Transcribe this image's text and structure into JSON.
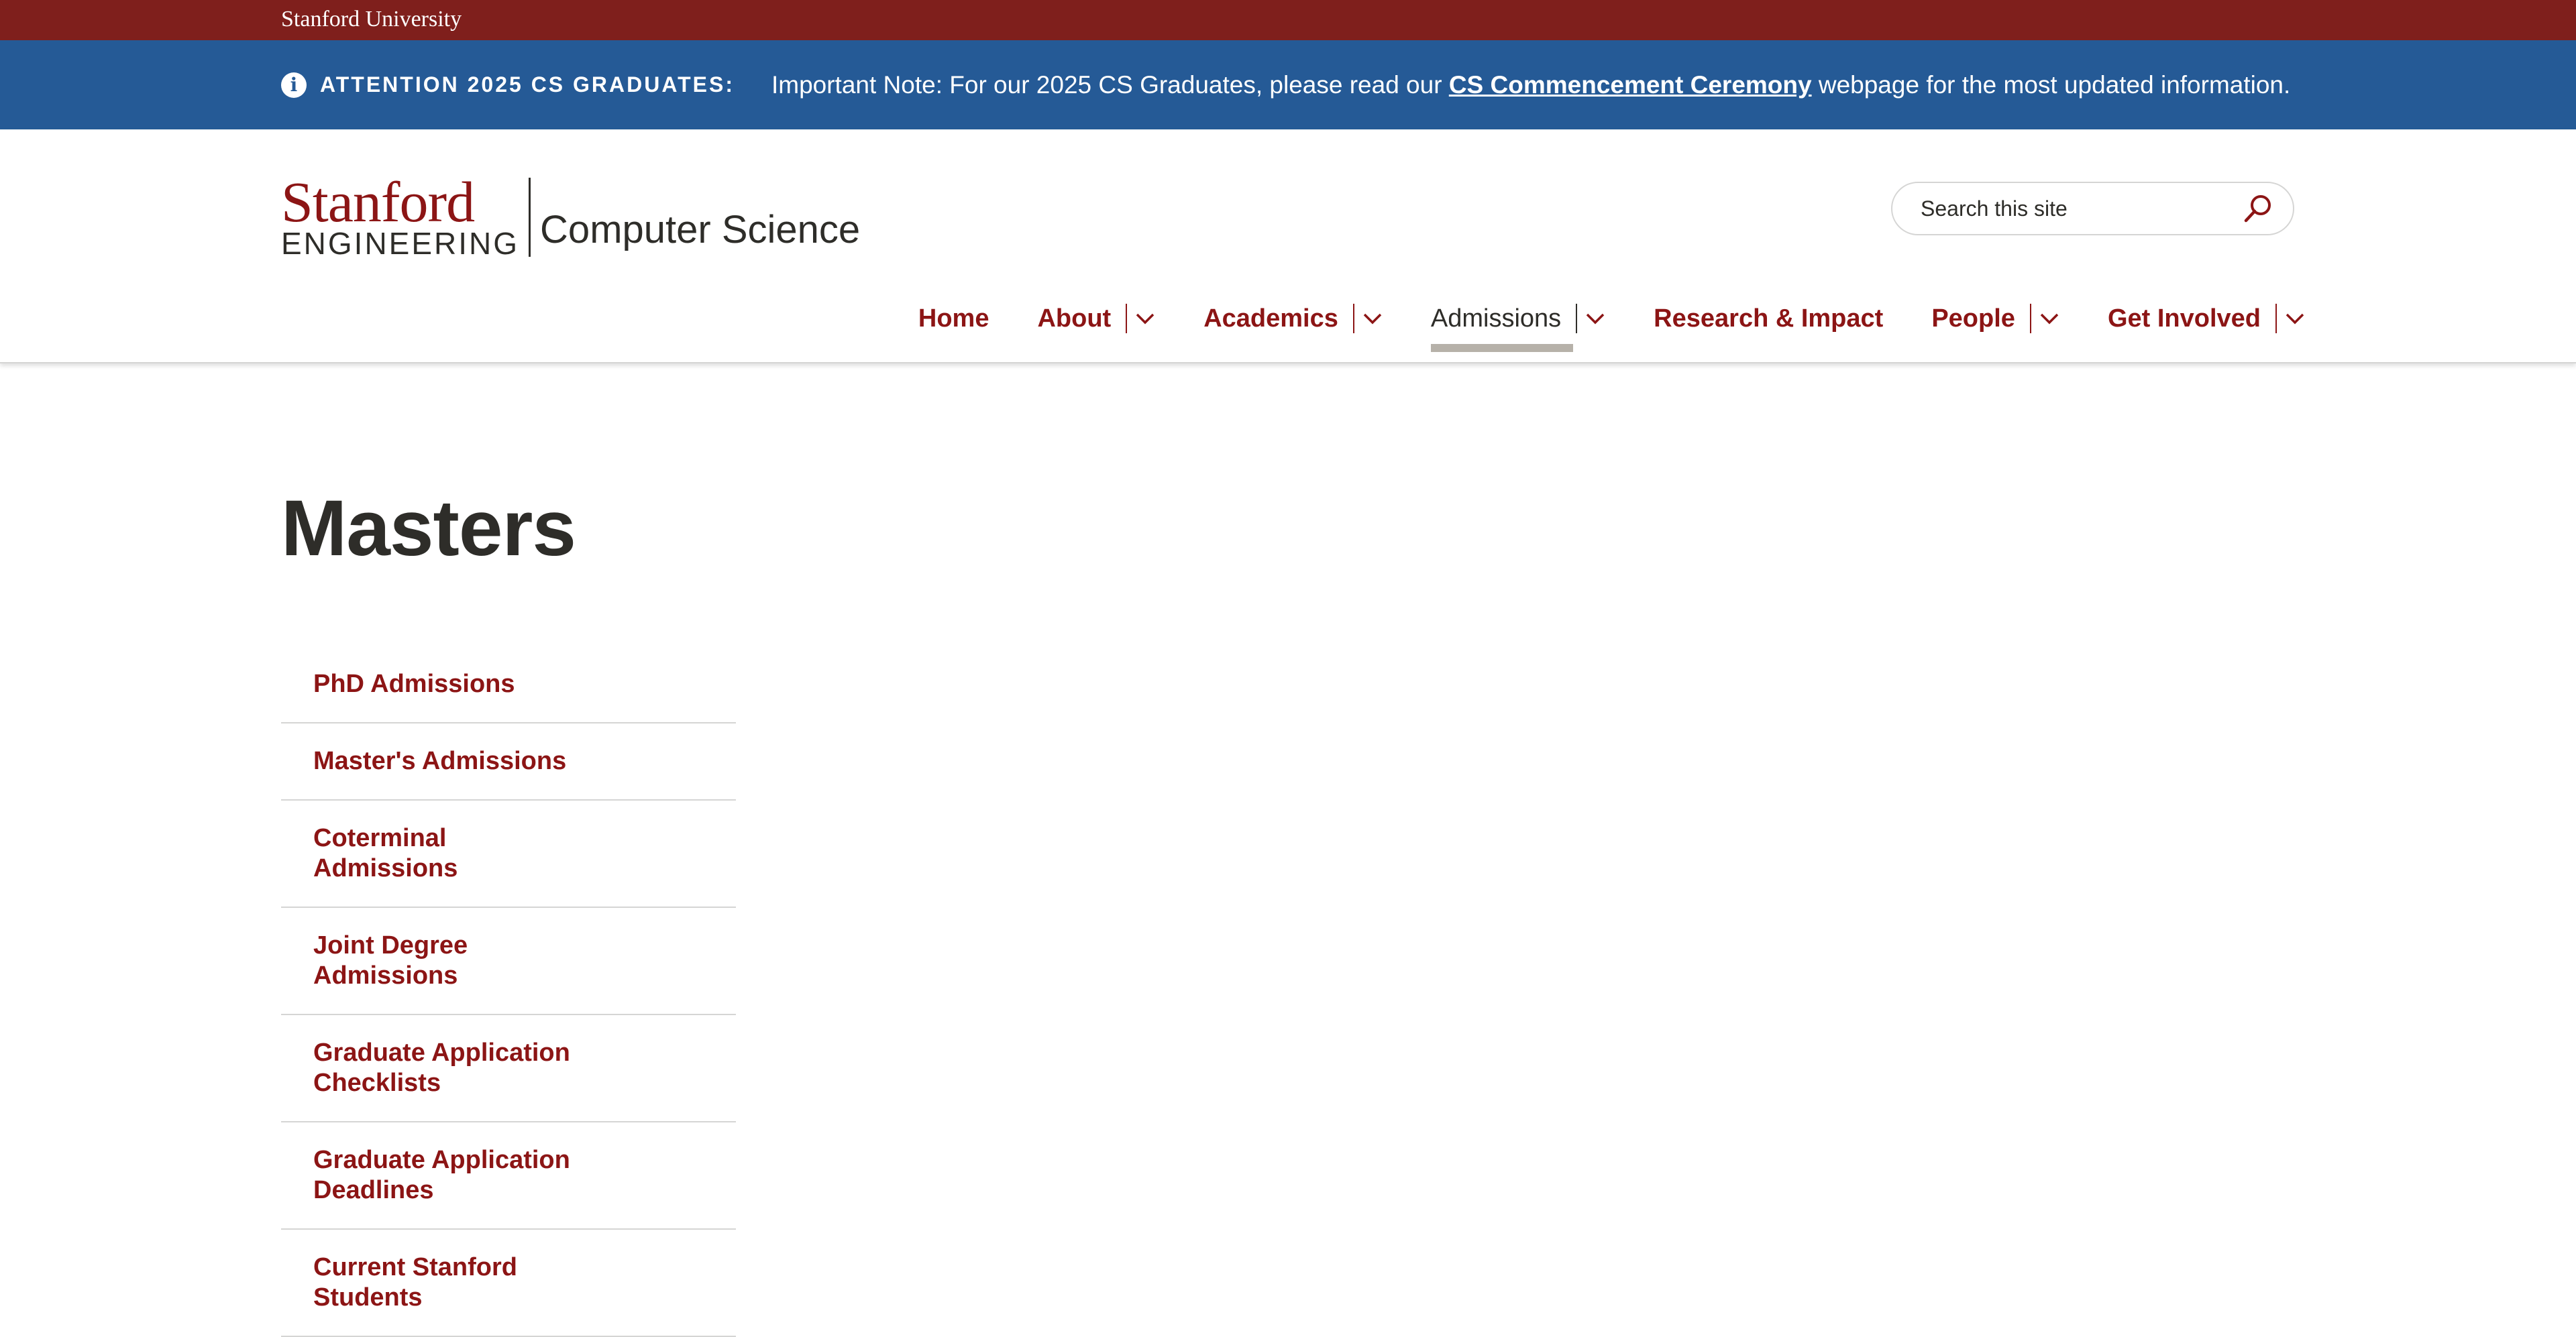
{
  "global_header": {
    "university_link": "Stanford University"
  },
  "alert": {
    "icon": "info-circle-icon",
    "label": "ATTENTION 2025 CS GRADUATES:",
    "message_before": "Important Note: For our 2025 CS Graduates, please read our ",
    "link_text": "CS Commencement Ceremony",
    "message_after": " webpage for the most updated information."
  },
  "brand": {
    "logo_line1": "Stanford",
    "logo_line2": "ENGINEERING",
    "site_name": "Computer Science"
  },
  "search": {
    "placeholder": "Search this site",
    "button_icon": "search-icon"
  },
  "main_nav": {
    "items": [
      {
        "label": "Home",
        "has_dropdown": false,
        "active": false
      },
      {
        "label": "About",
        "has_dropdown": true,
        "active": false
      },
      {
        "label": "Academics",
        "has_dropdown": true,
        "active": false
      },
      {
        "label": "Admissions",
        "has_dropdown": true,
        "active": true
      },
      {
        "label": "Research & Impact",
        "has_dropdown": false,
        "active": false
      },
      {
        "label": "People",
        "has_dropdown": true,
        "active": false
      },
      {
        "label": "Get Involved",
        "has_dropdown": true,
        "active": false
      }
    ]
  },
  "page": {
    "title": "Masters"
  },
  "side_nav": {
    "items": [
      "PhD Admissions",
      "Master's Admissions",
      "Coterminal Admissions",
      "Joint Degree Admissions",
      "Graduate Application Checklists",
      "Graduate Application Deadlines",
      "Current Stanford Students"
    ]
  },
  "colors": {
    "cardinal": "#8c1515",
    "top_bar": "#7f1f1c",
    "alert_blue": "#255a96",
    "text_dark": "#2e2d29",
    "divider": "#d5d5d4",
    "active_underline": "#b6b1a9"
  }
}
